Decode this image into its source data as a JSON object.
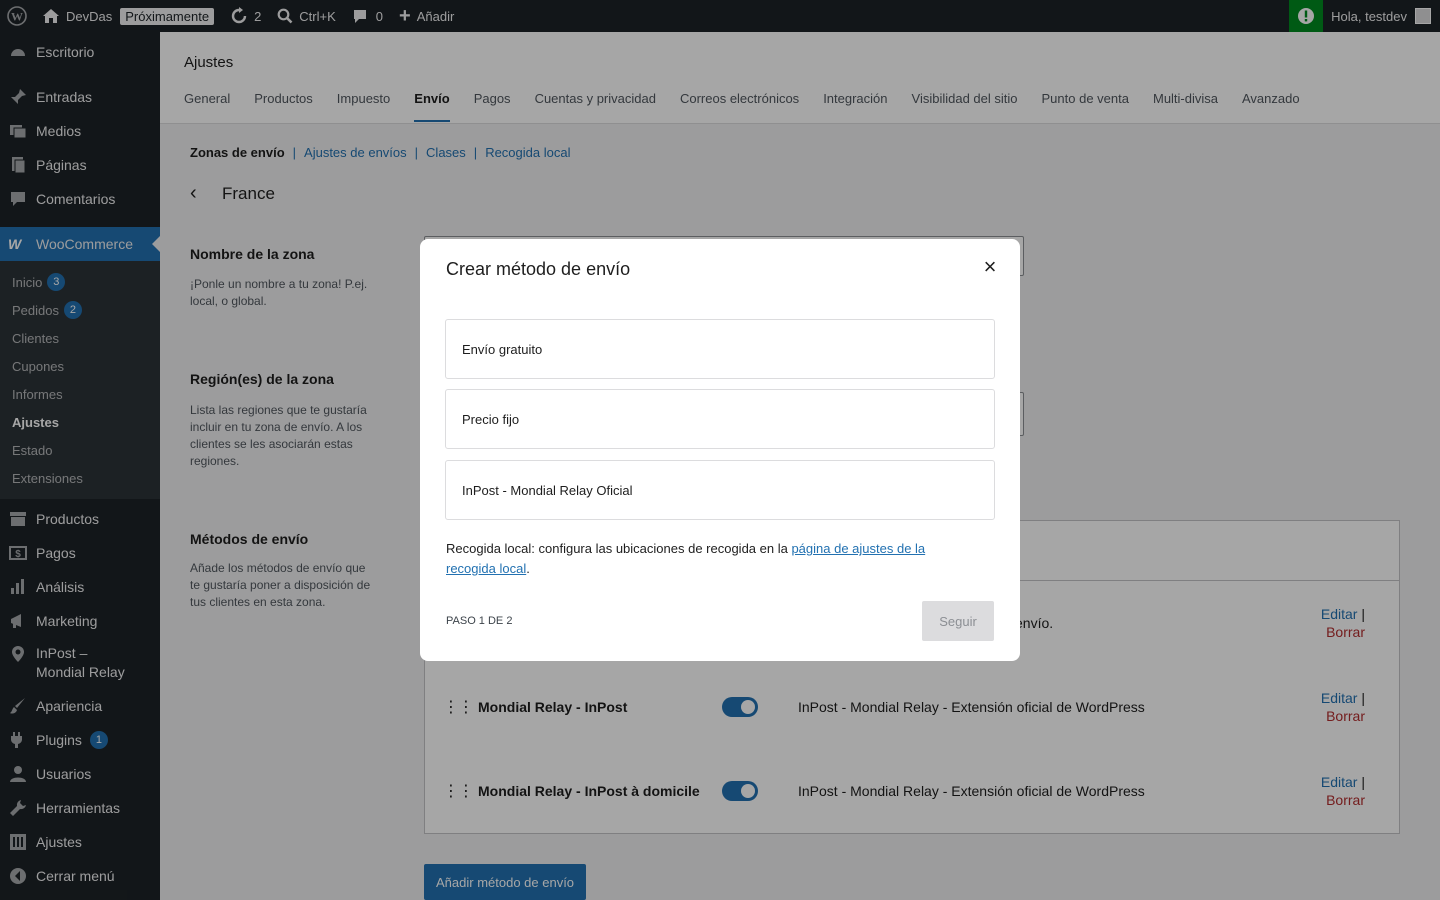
{
  "adminbar": {
    "site_name": "DevDas",
    "coming_soon": "Próximamente",
    "updates": "2",
    "search_shortcut": "Ctrl+K",
    "comments": "0",
    "add_new": "Añadir",
    "greeting": "Hola, testdev"
  },
  "sidebar": {
    "items_top": [
      "Escritorio",
      "Entradas",
      "Medios",
      "Páginas",
      "Comentarios"
    ],
    "woocommerce": "WooCommerce",
    "submenu": [
      {
        "label": "Inicio",
        "count": "3"
      },
      {
        "label": "Pedidos",
        "count": "2"
      },
      {
        "label": "Clientes"
      },
      {
        "label": "Cupones"
      },
      {
        "label": "Informes"
      },
      {
        "label": "Ajustes"
      },
      {
        "label": "Estado"
      },
      {
        "label": "Extensiones"
      }
    ],
    "items_mid": [
      "Productos",
      "Pagos",
      "Análisis",
      "Marketing"
    ],
    "inpost_line1": "InPost –",
    "inpost_line2": "Mondial Relay",
    "items_bottom": [
      "Apariencia",
      "Plugins",
      "Usuarios",
      "Herramientas",
      "Ajustes",
      "Cerrar menú"
    ],
    "plugins_count": "1"
  },
  "header": {
    "title": "Ajustes",
    "tabs": [
      "General",
      "Productos",
      "Impuesto",
      "Envío",
      "Pagos",
      "Cuentas y privacidad",
      "Correos electrónicos",
      "Integración",
      "Visibilidad del sitio",
      "Punto de venta",
      "Multi-divisa",
      "Avanzado"
    ],
    "active_tab": "Envío"
  },
  "subsub": {
    "current": "Zonas de envío",
    "links": [
      "Ajustes de envíos",
      "Clases",
      "Recogida local"
    ]
  },
  "zone": {
    "name": "France",
    "name_title": "Nombre de la zona",
    "name_desc": "¡Ponle un nombre a tu zona! P.ej. local, o global.",
    "region_title": "Región(es) de la zona",
    "region_desc": "Lista las regiones que te gustaría incluir en tu zona de envío. A los clientes se les asociarán estas regiones.",
    "methods_title": "Métodos de envío",
    "methods_desc": "Añade los métodos de envío que te gustaría poner a disposición de tus clientes en esta zona."
  },
  "methods": {
    "partial_desc": "envío.",
    "rows": [
      {
        "name": "Mondial Relay - InPost",
        "desc": "InPost - Mondial Relay - Extensión oficial de WordPress"
      },
      {
        "name": "Mondial Relay - InPost à domicile",
        "desc": "InPost - Mondial Relay - Extensión oficial de WordPress"
      }
    ],
    "edit": "Editar",
    "sep": "|",
    "delete": "Borrar",
    "add_button": "Añadir método de envío"
  },
  "modal": {
    "title": "Crear método de envío",
    "close": "×",
    "options": [
      "Envío gratuito",
      "Precio fijo",
      "InPost - Mondial Relay Oficial"
    ],
    "note_prefix": "Recogida local: configura las ubicaciones de recogida en la ",
    "note_link": "página de ajustes de la recogida local",
    "note_suffix": ".",
    "step": "PASO 1 DE 2",
    "next": "Seguir"
  },
  "colors": {
    "admin_dark": "#1d2327",
    "accent": "#2271b1",
    "delete": "#b32d2e",
    "notice_green": "#008a20"
  }
}
